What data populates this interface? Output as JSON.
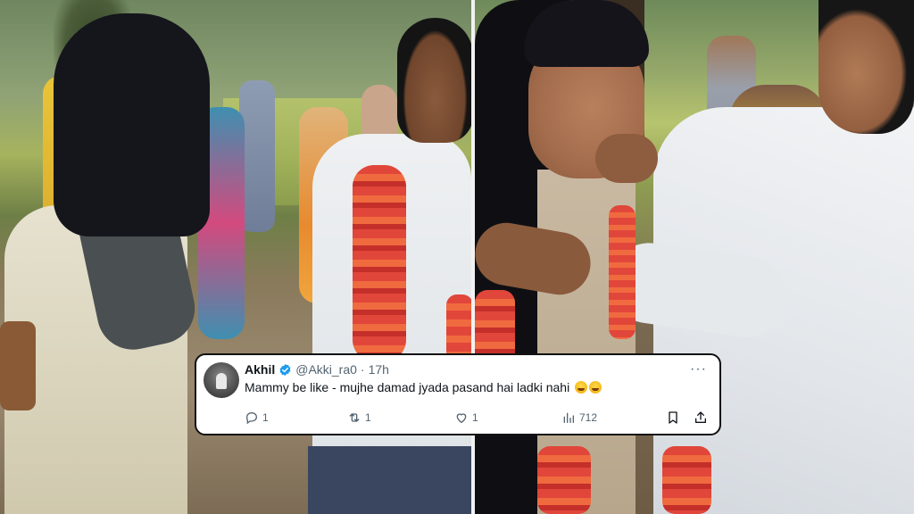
{
  "tweet": {
    "display_name": "Akhil",
    "handle": "@Akki_ra0",
    "separator": "·",
    "time": "17h",
    "more": "···",
    "text": "Mammy be like - mujhe damad jyada pasand hai ladki nahi",
    "emoji": [
      "rolling-on-floor-laughing-emoji",
      "rolling-on-floor-laughing-emoji"
    ],
    "counts": {
      "replies": "1",
      "reposts": "1",
      "likes": "1",
      "views": "712"
    },
    "colors": {
      "text": "#0f1419",
      "secondary": "#536471",
      "verified": "#1d9bf0",
      "card_border": "#111111"
    },
    "icons": {
      "reply": "reply-icon",
      "repost": "repost-icon",
      "like": "heart-icon",
      "views": "views-bar-chart-icon",
      "bookmark": "bookmark-icon",
      "share": "share-icon",
      "verified": "verified-badge-icon"
    }
  }
}
